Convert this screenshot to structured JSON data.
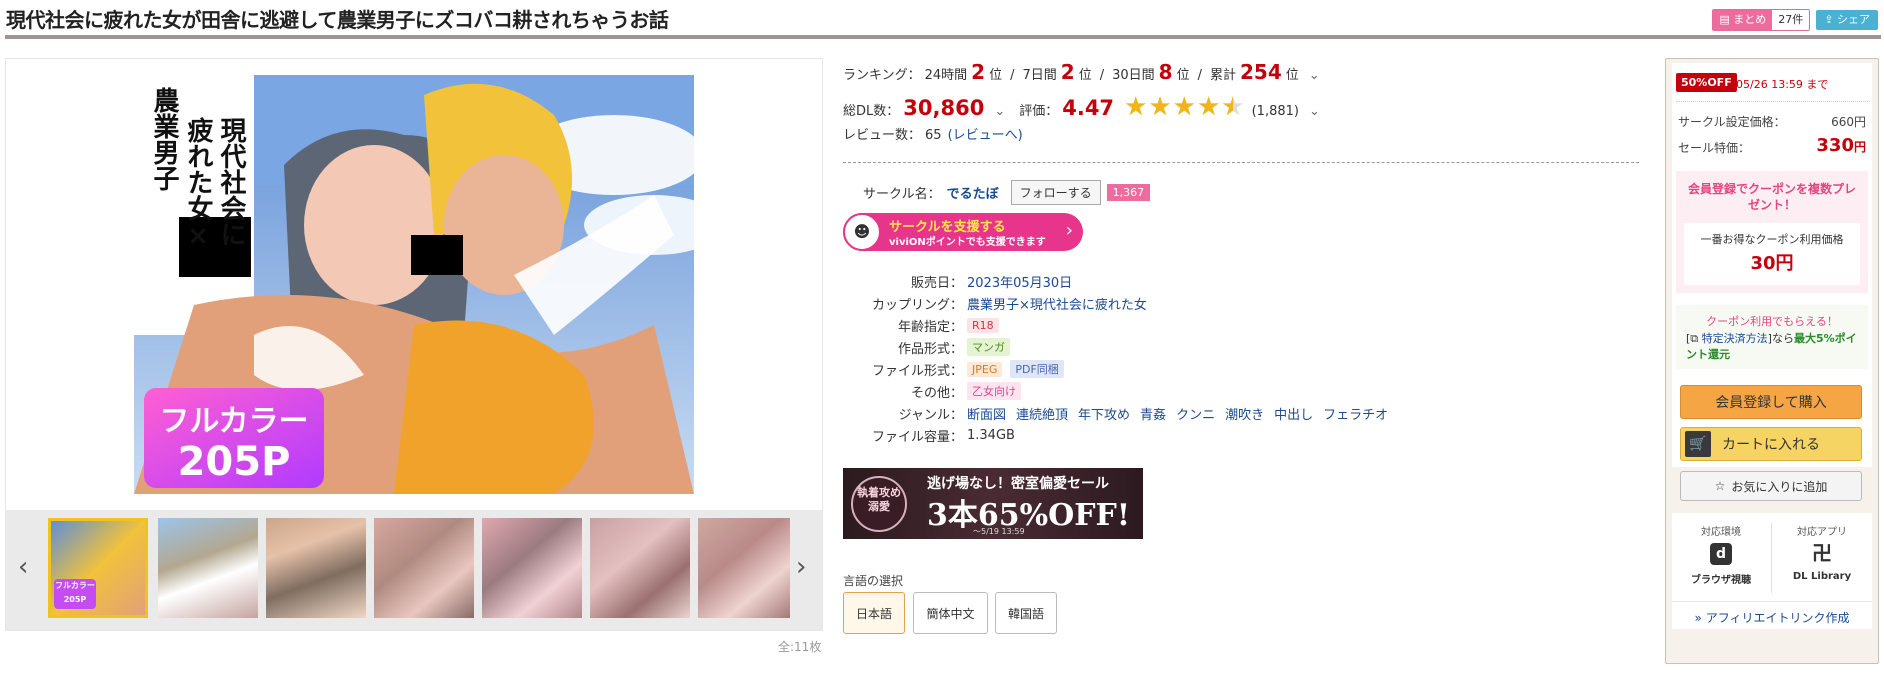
{
  "title": "現代社会に疲れた女が田舎に逃避して農業男子にズコバコ耕されちゃうお話",
  "header": {
    "matome_label": "まとめ",
    "matome_count": "27件",
    "share_label": "シェア"
  },
  "cover": {
    "title_lines": [
      "現代社会に",
      "疲れた女×",
      "農業男子"
    ],
    "badge_line1": "フルカラー",
    "badge_line2": "205P"
  },
  "gallery": {
    "count": "全:11枚",
    "thumb_badge": "フルカラー 205P"
  },
  "ranking": {
    "label": "ランキング：",
    "h24_label": "24時間",
    "h24_rank": "2",
    "d7_label": "7日間",
    "d7_rank": "2",
    "d30_label": "30日間",
    "d30_rank": "8",
    "total_label": "累計",
    "total_rank": "254",
    "unit": "位"
  },
  "stats": {
    "dl_label": "総DL数：",
    "dl_count": "30,860",
    "rating_label": "評価：",
    "rating": "4.47",
    "rating_stars": 4.47,
    "rating_count": "(1,881)",
    "review_label": "レビュー数：",
    "review_count": "65",
    "review_link": "(レビューへ)"
  },
  "circle": {
    "label": "サークル名：",
    "name": "でるたぼ",
    "follow": "フォローする",
    "followers": "1,367"
  },
  "support": {
    "line1": "サークルを支援する",
    "line2": "viviONポイントでも支援できます"
  },
  "details": {
    "release_k": "販売日：",
    "release_v": "2023年05月30日",
    "coupling_k": "カップリング：",
    "coupling_v": "農業男子×現代社会に疲れた女",
    "age_k": "年齢指定：",
    "age_v": "R18",
    "type_k": "作品形式：",
    "type_v": "マンガ",
    "file_k": "ファイル形式：",
    "file_v1": "JPEG",
    "file_v2": "PDF同梱",
    "other_k": "その他：",
    "other_v": "乙女向け",
    "genre_k": "ジャンル：",
    "genres": [
      "断面図",
      "連続絶頂",
      "年下攻め",
      "青姦",
      "クンニ",
      "潮吹き",
      "中出し",
      "フェラチオ"
    ],
    "size_k": "ファイル容量：",
    "size_v": "1.34GB"
  },
  "banner": {
    "left": "執着攻め溺愛",
    "top": "逃げ場なし！密室偏愛セール",
    "main": "3本65%OFF!",
    "date": "～5/19 13:59"
  },
  "language": {
    "label": "言語の選択",
    "options": [
      "日本語",
      "簡体中文",
      "韓国語"
    ]
  },
  "sidebar": {
    "sale_badge": "50%OFF",
    "sale_until": "05/26 13:59 まで",
    "price_label": "サークル設定価格：",
    "price": "660円",
    "sale_label": "セール特価：",
    "sale_price": "330",
    "yen": "円",
    "coupon_title": "会員登録でクーポンを複数プレゼント！",
    "coupon_sub": "一番お得なクーポン利用価格",
    "coupon_price": "30円",
    "coupon_note": "クーポン利用でもらえる！",
    "payment_prefix": "[",
    "payment_link": "特定決済方法",
    "payment_suffix": "]なら",
    "payment_bonus": "最大5%ポイント還元",
    "buy": "会員登録して購入",
    "cart": "カートに入れる",
    "fav": "お気に入りに追加",
    "env_label": "対応環境",
    "env_name": "ブラウザ視聴",
    "app_label": "対応アプリ",
    "app_name": "DL Library",
    "affiliate": "アフィリエイトリンク作成"
  },
  "colors": {
    "accent_red": "#c4000d",
    "link_blue": "#1b4a8f",
    "orange_btn": "#f5a544",
    "yellow_btn": "#f6d463"
  }
}
